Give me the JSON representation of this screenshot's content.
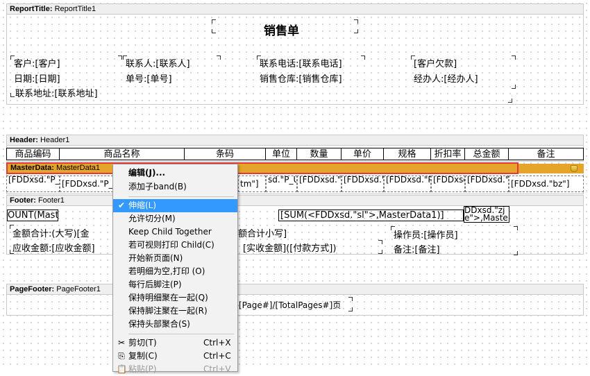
{
  "bands": {
    "report_title": {
      "type": "ReportTitle:",
      "name": "ReportTitle1"
    },
    "header": {
      "type": "Header:",
      "name": "Header1"
    },
    "master": {
      "type": "MasterData:",
      "name": "MasterData1"
    },
    "footer": {
      "type": "Footer:",
      "name": "Footer1"
    },
    "page_footer": {
      "type": "PageFooter:",
      "name": "PageFooter1"
    }
  },
  "title": {
    "heading": "销售单",
    "customer": "客户:[客户]",
    "contact": "联系人:[联系人]",
    "phone": "联系电话:[联系电话]",
    "debt": "[客户欠款]",
    "date": "日期:[日期]",
    "number": "单号:[单号]",
    "warehouse": "销售仓库:[销售仓库]",
    "handler": "经办人:[经办人]",
    "address": "联系地址:[联系地址]"
  },
  "columns": [
    "商品编码",
    "商品名称",
    "条码",
    "单位",
    "数量",
    "单价",
    "规格",
    "折扣率",
    "总金额",
    "备注"
  ],
  "data_cells": [
    "[FDDxsd.\"P_ID\"]",
    "[FDDxsd.\"P_",
    "tm\"]",
    "sd.\"P_Unit",
    "[FDDxsd.\"sl\"]",
    "[FDDxsd.\"dj\"]",
    "[FDDxsd.\"P_Type\"]",
    "[FDDxsd.\"dzl\"]",
    "[FDDxsd.\"zje\"]",
    "[FDDxsd.\"bz\"]"
  ],
  "footer": {
    "count": "OUNT(Mast",
    "sum": "[SUM(<FDDxsd.\"sl\">,MasterData1)]",
    "sum_right": "DDxsd.\"zj e\">,Maste",
    "total_label": "金额合计:(大写)[金",
    "total_small": "额合计小写]",
    "operator": "操作员:[操作员]",
    "due": "应收金额:[应收金额]",
    "paid": "[实收金额]([付款方式])",
    "remark": "备注:[备注]"
  },
  "page_footer_text": "§[Page#]/[TotalPages#]页",
  "menu": {
    "items": [
      {
        "label": "编辑(J)...",
        "shortcut": "",
        "icon": ""
      },
      {
        "label": "添加子band(B)",
        "shortcut": "",
        "icon": ""
      },
      {
        "label": "伸缩(L)",
        "shortcut": "",
        "icon": "✔"
      },
      {
        "label": "允许切分(M)",
        "shortcut": "",
        "icon": ""
      },
      {
        "label": "Keep Child Together",
        "shortcut": "",
        "icon": ""
      },
      {
        "label": " 若可视则打印 Child(C)",
        "shortcut": "",
        "icon": ""
      },
      {
        "label": "开始新页面(N)",
        "shortcut": "",
        "icon": ""
      },
      {
        "label": "若明细为空,打印 (O)",
        "shortcut": "",
        "icon": ""
      },
      {
        "label": "每行后脚注(P)",
        "shortcut": "",
        "icon": ""
      },
      {
        "label": "保持明细聚在一起(Q)",
        "shortcut": "",
        "icon": ""
      },
      {
        "label": "保持脚注聚在一起(R)",
        "shortcut": "",
        "icon": ""
      },
      {
        "label": "保持头部聚合(S)",
        "shortcut": "",
        "icon": ""
      },
      {
        "label": "剪切(T)",
        "shortcut": "Ctrl+X",
        "icon": "✂"
      },
      {
        "label": "复制(C)",
        "shortcut": "Ctrl+C",
        "icon": "⎘"
      },
      {
        "label": "粘贴(P)",
        "shortcut": "Ctrl+V",
        "icon": "📋"
      }
    ]
  },
  "colors": {
    "master_band": "#e5a52a",
    "selection_border": "#e0383c",
    "menu_highlight": "#3399ff"
  }
}
